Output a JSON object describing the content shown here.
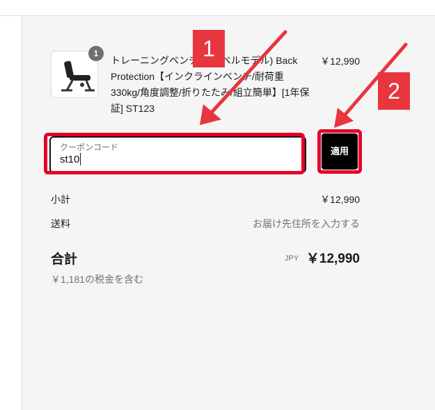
{
  "product": {
    "quantity": "1",
    "name": "トレーニングベンチ(ダンベルモデル) Back Protection【インクラインベンチ/耐荷重330kg/角度調整/折りたたみ/組立簡単】[1年保証] ST123",
    "price": "￥12,990",
    "image_icon": "weight-bench-icon"
  },
  "coupon": {
    "label": "クーポンコード",
    "value": "st10",
    "apply_label": "適用"
  },
  "summary": {
    "subtotal_label": "小計",
    "subtotal_value": "￥12,990",
    "shipping_label": "送料",
    "shipping_value": "お届け先住所を入力する",
    "total_label": "合計",
    "currency": "JPY",
    "total_value": "￥12,990",
    "tax_note": "￥1,181の税金を含む"
  },
  "annotations": {
    "callout_1": "1",
    "callout_2": "2",
    "color": "#e8363e"
  }
}
